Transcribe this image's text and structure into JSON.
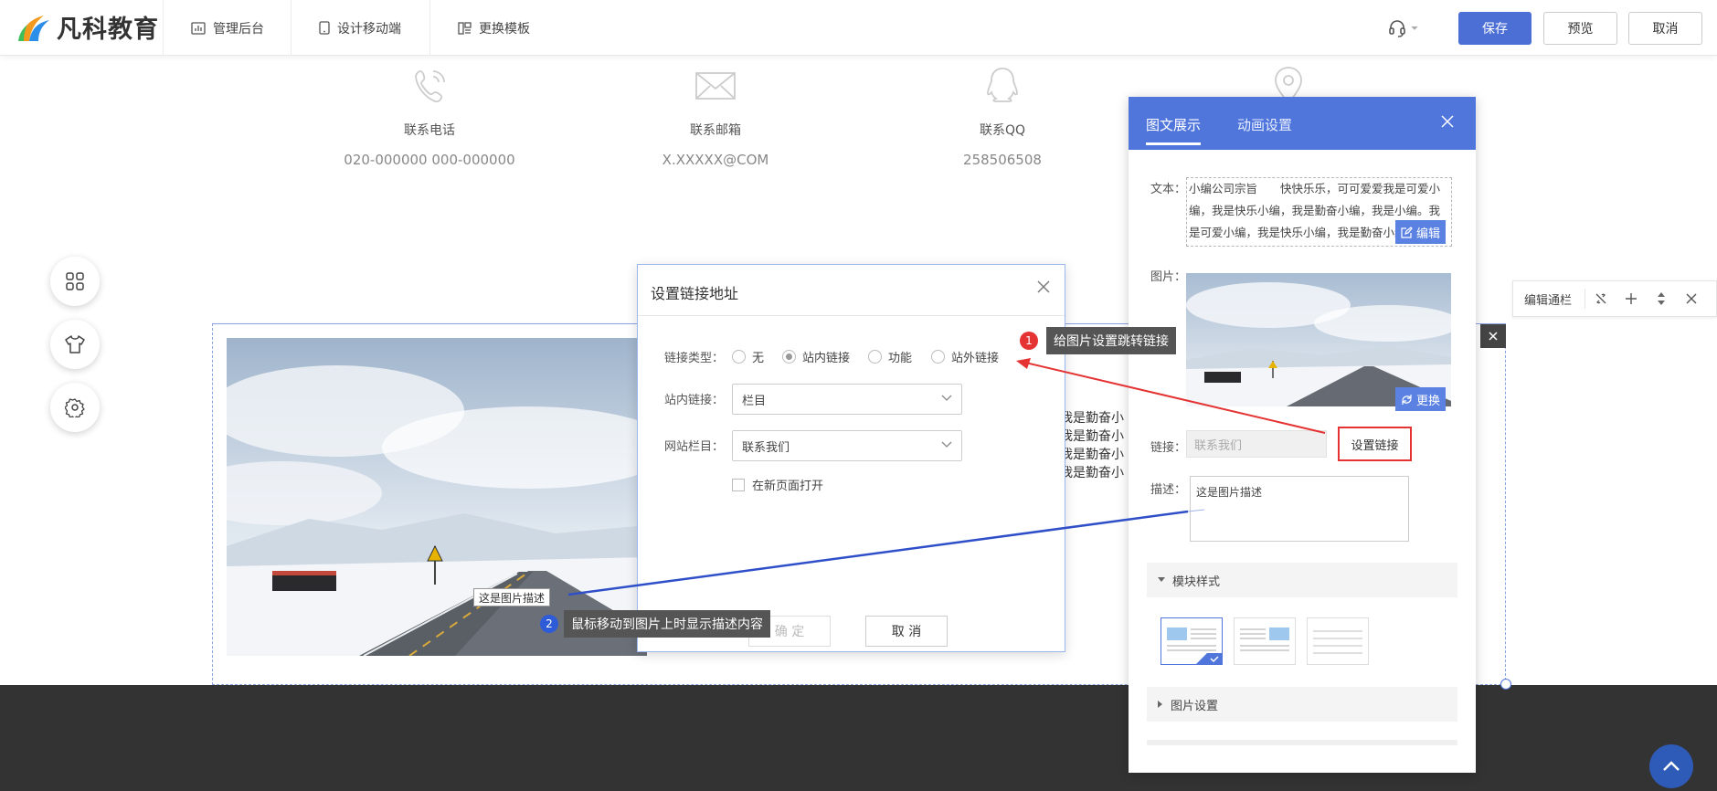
{
  "topbar": {
    "logo_text": "凡科教育",
    "nav": [
      "管理后台",
      "设计移动端",
      "更换模板"
    ],
    "save_label": "保存",
    "preview_label": "预览",
    "cancel_label": "取消"
  },
  "contacts": [
    {
      "icon": "phone-icon",
      "label": "联系电话",
      "value": "020-000000 000-000000"
    },
    {
      "icon": "mail-icon",
      "label": "联系邮箱",
      "value": "X.XXXXX@COM"
    },
    {
      "icon": "qq-icon",
      "label": "联系QQ",
      "value": "258506508"
    },
    {
      "icon": "location-icon",
      "label": "",
      "value": ""
    }
  ],
  "body_text_lines": [
    "我是勤奋小",
    "我是勤奋小",
    "我是勤奋小",
    "我是勤奋小"
  ],
  "dialog": {
    "title": "设置链接地址",
    "link_type_label": "链接类型：",
    "radio_options": [
      "无",
      "站内链接",
      "功能",
      "站外链接"
    ],
    "selected_radio": "站内链接",
    "internal_link_label": "站内链接：",
    "internal_link_value": "栏目",
    "site_column_label": "网站栏目：",
    "site_column_value": "联系我们",
    "new_page_label": "在新页面打开",
    "ok_label": "确 定",
    "cancel_label": "取 消"
  },
  "panel": {
    "tab_active": "图文展示",
    "tab_other": "动画设置",
    "text_label": "文本：",
    "text_content": "小编公司宗旨　　快快乐乐，可可爱爱我是可爱小编，我是快乐小编，我是勤奋小编，我是小编。我是可爱小编，我是快乐小编，我是勤奋小编",
    "edit_label": "编辑",
    "image_label": "图片：",
    "replace_label": "更换",
    "link_label": "链接：",
    "link_value": "联系我们",
    "set_link_label": "设置链接",
    "desc_label": "描述：",
    "desc_value": "这是图片描述",
    "module_style_label": "模块样式",
    "image_settings_label": "图片设置"
  },
  "navbar_tools": {
    "label": "编辑通栏"
  },
  "annotations": {
    "step1_num": "1",
    "step1_text": "给图片设置跳转链接",
    "step2_num": "2",
    "step2_text": "鼠标移动到图片上时显示描述内容",
    "img_desc_tip": "这是图片描述"
  },
  "colors": {
    "accent": "#5076dc",
    "save": "#4c6fd6",
    "highlight": "#e53333",
    "footer": "#333333"
  }
}
